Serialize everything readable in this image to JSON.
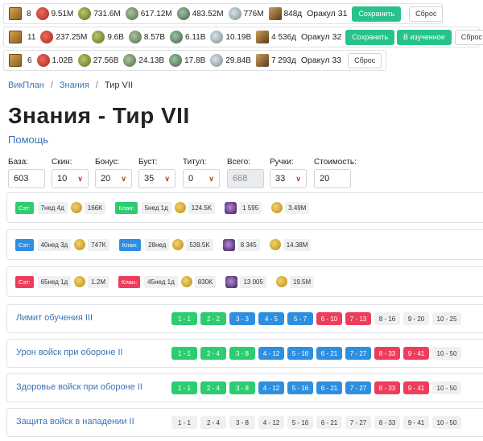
{
  "resource_rows": [
    {
      "scrolls": "8",
      "meat": "9.51M",
      "wood": "731.6M",
      "stone": "617.12M",
      "iron": "483.52M",
      "silver": "776M",
      "oracle_value": "848д",
      "oracle_label": "Оракул 31",
      "buttons": [
        "Сохранить",
        "Сброс"
      ]
    },
    {
      "scrolls": "11",
      "meat": "237.25M",
      "wood": "9.6B",
      "stone": "8.57B",
      "iron": "6.11B",
      "silver": "10.19B",
      "oracle_value": "4 536д",
      "oracle_label": "Оракул 32",
      "buttons": [
        "Сохранить",
        "В изученное",
        "Сброс"
      ]
    },
    {
      "scrolls": "6",
      "meat": "1.02B",
      "wood": "27.56B",
      "stone": "24.13B",
      "iron": "17.8B",
      "silver": "29.84B",
      "oracle_value": "7 293д",
      "oracle_label": "Оракул 33",
      "buttons": [
        "Сброс"
      ]
    }
  ],
  "breadcrumb": {
    "root": "ВикПлан",
    "section": "Знания",
    "current": "Тир VII",
    "sep": "/"
  },
  "page_title": "Знания - Тир VII",
  "help_link": "Помощь",
  "fields": [
    {
      "label": "База:",
      "value": "603"
    },
    {
      "label": "Скин:",
      "value": "10"
    },
    {
      "label": "Бонус:",
      "value": "20"
    },
    {
      "label": "Буст:",
      "value": "35"
    },
    {
      "label": "Титул:",
      "value": "0"
    },
    {
      "label": "Всего:",
      "value": "668"
    },
    {
      "label": "Ручки:",
      "value": "33"
    },
    {
      "label": "Стоимость:",
      "value": "20"
    }
  ],
  "cost_cards": [
    {
      "tag1": "Сэт:",
      "time1": "7нед 4д",
      "cost1": "166K",
      "tag2": "Клан:",
      "time2": "5нед 1д",
      "cost2": "124.5K",
      "crystals": "1 595",
      "gold": "3.49M"
    },
    {
      "tag1": "Сэт:",
      "time1": "40нед 3д",
      "cost1": "747K",
      "tag2": "Клан:",
      "time2": "28нед",
      "cost2": "539.5K",
      "crystals": "8 345",
      "gold": "14.38M"
    },
    {
      "tag1": "Сэт:",
      "time1": "65нед 1д",
      "cost1": "1.2M",
      "tag2": "Клан:",
      "time2": "45нед 1д",
      "cost2": "830K",
      "crystals": "13 005",
      "gold": "19.5M"
    }
  ],
  "skills": [
    {
      "name": "Лимит обучения III",
      "levels": [
        "1 - 1",
        "2 - 2",
        "3 - 3",
        "4 - 5",
        "5 - 7",
        "6 - 10",
        "7 - 13",
        "8 - 16",
        "9 - 20",
        "10 - 25"
      ]
    },
    {
      "name": "Урон войск при обороне II",
      "levels": [
        "1 - 1",
        "2 - 4",
        "3 - 8",
        "4 - 12",
        "5 - 16",
        "6 - 21",
        "7 - 27",
        "8 - 33",
        "9 - 41",
        "10 - 50"
      ]
    },
    {
      "name": "Здоровье войск при обороне II",
      "levels": [
        "1 - 1",
        "2 - 4",
        "3 - 8",
        "4 - 12",
        "5 - 16",
        "6 - 21",
        "7 - 27",
        "8 - 33",
        "9 - 41",
        "10 - 50"
      ]
    },
    {
      "name": "Защита войск в нападении II",
      "levels": [
        "1 - 1",
        "2 - 4",
        "3 - 8",
        "4 - 12",
        "5 - 16",
        "6 - 21",
        "7 - 27",
        "8 - 33",
        "9 - 41",
        "10 - 50"
      ]
    }
  ],
  "colors": {
    "green": "#2ecc71",
    "blue": "#2e8fe0",
    "red": "#ee3d5c",
    "link": "#3a73b7",
    "save_green": "#28c38a"
  }
}
